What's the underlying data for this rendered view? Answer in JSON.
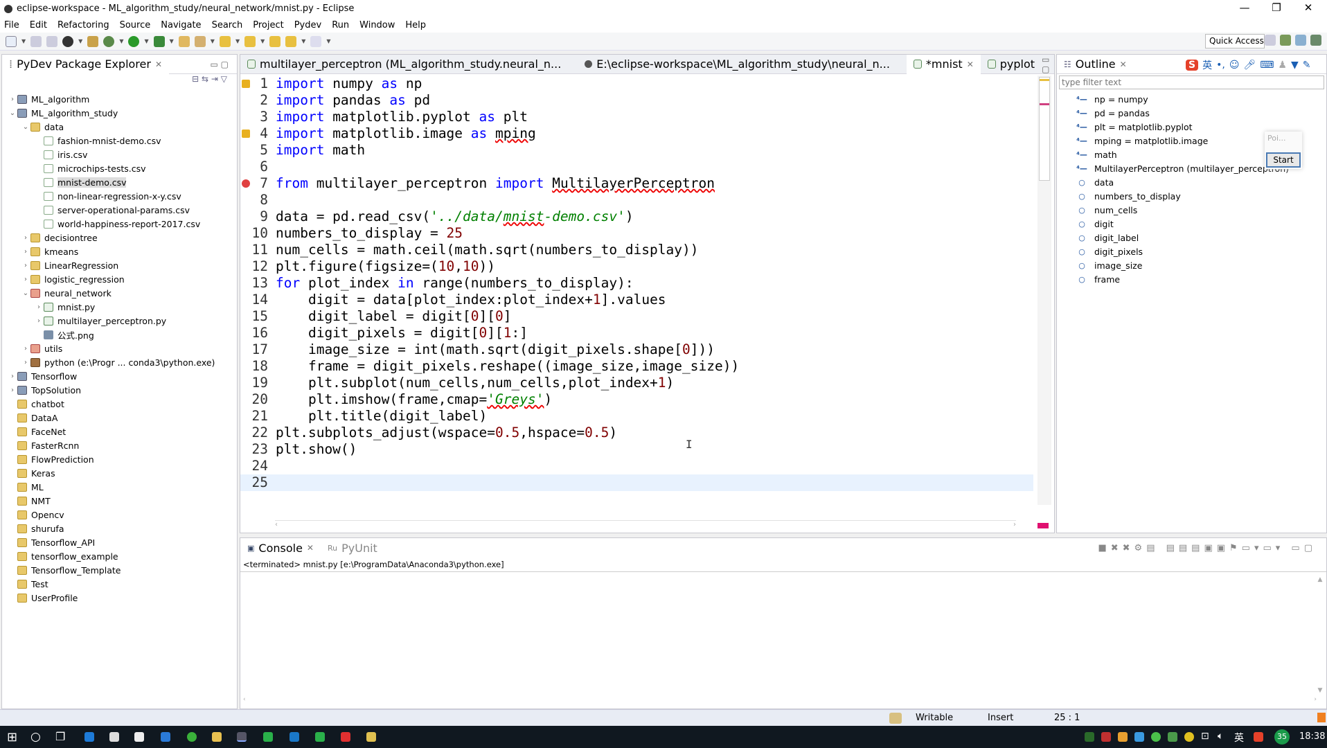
{
  "window": {
    "title": "eclipse-workspace - ML_algorithm_study/neural_network/mnist.py - Eclipse",
    "controls": [
      "—",
      "❐",
      "✕"
    ]
  },
  "menu": [
    "File",
    "Edit",
    "Refactoring",
    "Source",
    "Navigate",
    "Search",
    "Project",
    "Pydev",
    "Run",
    "Window",
    "Help"
  ],
  "toolbar": {
    "quick_access": "Quick Access"
  },
  "explorer": {
    "title": "PyDev Package Explorer",
    "items": [
      {
        "label": "ML_algorithm",
        "lvl": 0,
        "arrow": "›",
        "icon": "proj"
      },
      {
        "label": "ML_algorithm_study",
        "lvl": 0,
        "arrow": "⌄",
        "icon": "proj"
      },
      {
        "label": "data",
        "lvl": 1,
        "arrow": "⌄",
        "icon": "fold"
      },
      {
        "label": "fashion-mnist-demo.csv",
        "lvl": 2,
        "arrow": "",
        "icon": "file"
      },
      {
        "label": "iris.csv",
        "lvl": 2,
        "arrow": "",
        "icon": "file"
      },
      {
        "label": "microchips-tests.csv",
        "lvl": 2,
        "arrow": "",
        "icon": "file"
      },
      {
        "label": "mnist-demo.csv",
        "lvl": 2,
        "arrow": "",
        "icon": "file",
        "selected": true
      },
      {
        "label": "non-linear-regression-x-y.csv",
        "lvl": 2,
        "arrow": "",
        "icon": "file"
      },
      {
        "label": "server-operational-params.csv",
        "lvl": 2,
        "arrow": "",
        "icon": "file"
      },
      {
        "label": "world-happiness-report-2017.csv",
        "lvl": 2,
        "arrow": "",
        "icon": "file"
      },
      {
        "label": "decisiontree",
        "lvl": 1,
        "arrow": "›",
        "icon": "fold"
      },
      {
        "label": "kmeans",
        "lvl": 1,
        "arrow": "›",
        "icon": "fold"
      },
      {
        "label": "LinearRegression",
        "lvl": 1,
        "arrow": "›",
        "icon": "fold"
      },
      {
        "label": "logistic_regression",
        "lvl": 1,
        "arrow": "›",
        "icon": "fold"
      },
      {
        "label": "neural_network",
        "lvl": 1,
        "arrow": "⌄",
        "icon": "pkg"
      },
      {
        "label": "mnist.py",
        "lvl": 2,
        "arrow": "›",
        "icon": "py"
      },
      {
        "label": "multilayer_perceptron.py",
        "lvl": 2,
        "arrow": "›",
        "icon": "py"
      },
      {
        "label": "公式.png",
        "lvl": 2,
        "arrow": "",
        "icon": "png"
      },
      {
        "label": "utils",
        "lvl": 1,
        "arrow": "›",
        "icon": "pkg"
      },
      {
        "label": "python  (e:\\Progr ... conda3\\python.exe)",
        "lvl": 1,
        "arrow": "›",
        "icon": "lib"
      },
      {
        "label": "Tensorflow",
        "lvl": 0,
        "arrow": "›",
        "icon": "proj"
      },
      {
        "label": "TopSolution",
        "lvl": 0,
        "arrow": "›",
        "icon": "proj"
      },
      {
        "label": "chatbot",
        "lvl": 0,
        "arrow": "",
        "icon": "fold"
      },
      {
        "label": "DataA",
        "lvl": 0,
        "arrow": "",
        "icon": "fold"
      },
      {
        "label": "FaceNet",
        "lvl": 0,
        "arrow": "",
        "icon": "fold"
      },
      {
        "label": "FasterRcnn",
        "lvl": 0,
        "arrow": "",
        "icon": "fold"
      },
      {
        "label": "FlowPrediction",
        "lvl": 0,
        "arrow": "",
        "icon": "fold"
      },
      {
        "label": "Keras",
        "lvl": 0,
        "arrow": "",
        "icon": "fold"
      },
      {
        "label": "ML",
        "lvl": 0,
        "arrow": "",
        "icon": "fold"
      },
      {
        "label": "NMT",
        "lvl": 0,
        "arrow": "",
        "icon": "fold"
      },
      {
        "label": "Opencv",
        "lvl": 0,
        "arrow": "",
        "icon": "fold"
      },
      {
        "label": "shurufa",
        "lvl": 0,
        "arrow": "",
        "icon": "fold"
      },
      {
        "label": "Tensorflow_API",
        "lvl": 0,
        "arrow": "",
        "icon": "fold"
      },
      {
        "label": "tensorflow_example",
        "lvl": 0,
        "arrow": "",
        "icon": "fold"
      },
      {
        "label": "Tensorflow_Template",
        "lvl": 0,
        "arrow": "",
        "icon": "fold"
      },
      {
        "label": "Test",
        "lvl": 0,
        "arrow": "",
        "icon": "fold"
      },
      {
        "label": "UserProfile",
        "lvl": 0,
        "arrow": "",
        "icon": "fold"
      }
    ]
  },
  "editor": {
    "tabs": [
      {
        "label": "multilayer_perceptron (ML_algorithm_study.neural_n...",
        "active": false
      },
      {
        "label": "E:\\eclipse-workspace\\ML_algorithm_study\\neural_n...",
        "active": false
      },
      {
        "label": "*mnist",
        "active": true
      },
      {
        "label": "pyplot",
        "active": false
      }
    ],
    "current_line": 25,
    "markers": {
      "1": "warning",
      "4": "warning",
      "7": "error"
    },
    "lines": [
      [
        [
          "import",
          "kw"
        ],
        [
          " numpy ",
          ""
        ],
        [
          "as",
          "kw"
        ],
        [
          " np",
          ""
        ]
      ],
      [
        [
          "import",
          "kw"
        ],
        [
          " pandas ",
          ""
        ],
        [
          "as",
          "kw"
        ],
        [
          " pd",
          ""
        ]
      ],
      [
        [
          "import",
          "kw"
        ],
        [
          " matplotlib.pyplot ",
          ""
        ],
        [
          "as",
          "kw"
        ],
        [
          " plt",
          ""
        ]
      ],
      [
        [
          "import",
          "kw"
        ],
        [
          " matplotlib.image ",
          ""
        ],
        [
          "as",
          "kw"
        ],
        [
          " ",
          ""
        ],
        [
          "mping",
          "err"
        ]
      ],
      [
        [
          "import",
          "kw"
        ],
        [
          " math",
          ""
        ]
      ],
      [],
      [
        [
          "from",
          "kw"
        ],
        [
          " multilayer_perceptron ",
          ""
        ],
        [
          "import",
          "kw"
        ],
        [
          " ",
          ""
        ],
        [
          "MultilayerPerceptron",
          "err"
        ]
      ],
      [],
      [
        [
          "data = pd.read_csv(",
          ""
        ],
        [
          "'../data/",
          "str"
        ],
        [
          "mnist",
          "str err"
        ],
        [
          "-demo.csv'",
          "str"
        ],
        [
          ")",
          ""
        ]
      ],
      [
        [
          "numbers_to_display = ",
          ""
        ],
        [
          "25",
          "num"
        ]
      ],
      [
        [
          "num_cells = math.ceil(math.sqrt(numbers_to_display))",
          ""
        ]
      ],
      [
        [
          "plt.figure(figsize=(",
          ""
        ],
        [
          "10",
          "num"
        ],
        [
          ",",
          ""
        ],
        [
          "10",
          "num"
        ],
        [
          "))",
          ""
        ]
      ],
      [
        [
          "for",
          "kw"
        ],
        [
          " plot_index ",
          ""
        ],
        [
          "in",
          "kw"
        ],
        [
          " range(numbers_to_display):",
          ""
        ]
      ],
      [
        [
          "    digit = data[plot_index:plot_index+",
          ""
        ],
        [
          "1",
          "num"
        ],
        [
          "].values",
          ""
        ]
      ],
      [
        [
          "    digit_label = digit[",
          ""
        ],
        [
          "0",
          "num"
        ],
        [
          "][",
          ""
        ],
        [
          "0",
          "num"
        ],
        [
          "]",
          ""
        ]
      ],
      [
        [
          "    digit_pixels = digit[",
          ""
        ],
        [
          "0",
          "num"
        ],
        [
          "][",
          ""
        ],
        [
          "1",
          "num"
        ],
        [
          ":]",
          ""
        ]
      ],
      [
        [
          "    image_size = int(math.sqrt(digit_pixels.shape[",
          ""
        ],
        [
          "0",
          "num"
        ],
        [
          "]))",
          ""
        ]
      ],
      [
        [
          "    frame = digit_pixels.reshape((image_size,image_size))",
          ""
        ]
      ],
      [
        [
          "    plt.subplot(num_cells,num_cells,plot_index+",
          ""
        ],
        [
          "1",
          "num"
        ],
        [
          ")",
          ""
        ]
      ],
      [
        [
          "    plt.imshow(frame,cmap=",
          ""
        ],
        [
          "'Greys'",
          "str err"
        ],
        [
          ")",
          ""
        ]
      ],
      [
        [
          "    plt.title(digit_label)",
          ""
        ]
      ],
      [
        [
          "plt.subplots_adjust(wspace=",
          ""
        ],
        [
          "0.5",
          "num"
        ],
        [
          ",hspace=",
          ""
        ],
        [
          "0.5",
          "num"
        ],
        [
          ")",
          ""
        ]
      ],
      [
        [
          "plt.show()",
          ""
        ]
      ],
      [],
      []
    ]
  },
  "console": {
    "tabs": [
      "Console",
      "PyUnit"
    ],
    "status": "<terminated> mnist.py [e:\\ProgramData\\Anaconda3\\python.exe]"
  },
  "outline": {
    "title": "Outline",
    "filter_placeholder": "type filter text",
    "items": [
      {
        "label": "np = numpy",
        "kind": "import"
      },
      {
        "label": "pd = pandas",
        "kind": "import"
      },
      {
        "label": "plt = matplotlib.pyplot",
        "kind": "import"
      },
      {
        "label": "mping = matplotlib.image",
        "kind": "import"
      },
      {
        "label": "math",
        "kind": "import"
      },
      {
        "label": "MultilayerPerceptron (multilayer_perceptron)",
        "kind": "import"
      },
      {
        "label": "data",
        "kind": "var"
      },
      {
        "label": "numbers_to_display",
        "kind": "var"
      },
      {
        "label": "num_cells",
        "kind": "var"
      },
      {
        "label": "digit",
        "kind": "var"
      },
      {
        "label": "digit_label",
        "kind": "var"
      },
      {
        "label": "digit_pixels",
        "kind": "var"
      },
      {
        "label": "image_size",
        "kind": "var"
      },
      {
        "label": "frame",
        "kind": "var"
      }
    ]
  },
  "ime": {
    "lang": "英",
    "popup_text": "Poi...",
    "start_button": "Start"
  },
  "status": {
    "writable": "Writable",
    "mode": "Insert",
    "position": "25 : 1"
  },
  "taskbar": {
    "ime": "英",
    "badge": "35",
    "clock": "18:38"
  }
}
